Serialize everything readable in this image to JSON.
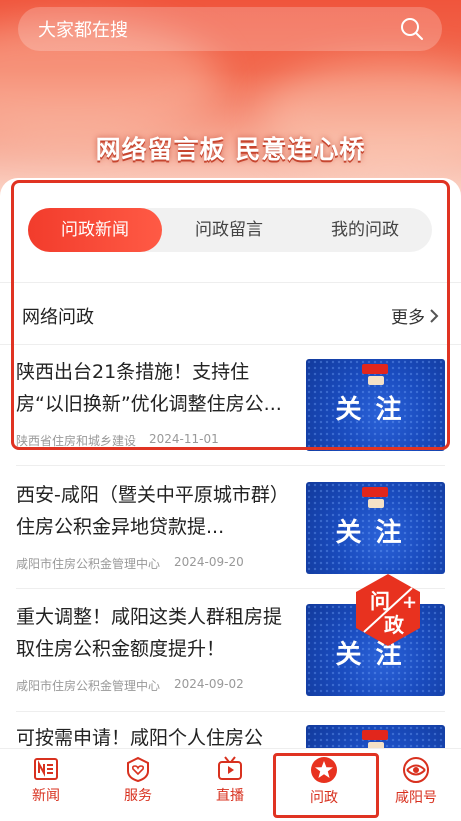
{
  "search": {
    "placeholder": "大家都在搜"
  },
  "banner": {
    "slogan": "网络留言板 民意连心桥"
  },
  "tabs": [
    {
      "label": "问政新闻",
      "active": true
    },
    {
      "label": "问政留言",
      "active": false
    },
    {
      "label": "我的问政",
      "active": false
    }
  ],
  "section": {
    "title": "网络问政",
    "more": "更多"
  },
  "news": [
    {
      "title": "陕西出台21条措施！支持住房“以旧换新”优化调整住房公...",
      "source": "陕西省住房和城乡建设",
      "date": "2024-11-01",
      "thumb_text": "关注"
    },
    {
      "title": "西安-咸阳（暨关中平原城市群）住房公积金异地贷款提...",
      "source": "咸阳市住房公积金管理中心",
      "date": "2024-09-20",
      "thumb_text": "关注"
    },
    {
      "title": "重大调整！咸阳这类人群租房提取住房公积金额度提升！",
      "source": "咸阳市住房公积金管理中心",
      "date": "2024-09-02",
      "thumb_text": "关注"
    },
    {
      "title": "可按需申请！咸阳个人住房公",
      "source": "",
      "date": "",
      "thumb_text": ""
    }
  ],
  "fab": {
    "top": "问",
    "bottom": "政",
    "plus": "+"
  },
  "tabbar": [
    {
      "label": "新闻",
      "icon": "news-icon"
    },
    {
      "label": "服务",
      "icon": "service-icon"
    },
    {
      "label": "直播",
      "icon": "live-tv-icon"
    },
    {
      "label": "问政",
      "icon": "star-badge-icon",
      "active": true
    },
    {
      "label": "咸阳号",
      "icon": "xianyang-logo-icon"
    }
  ],
  "colors": {
    "accent": "#e8321f",
    "highlight_box": "#e03322"
  }
}
